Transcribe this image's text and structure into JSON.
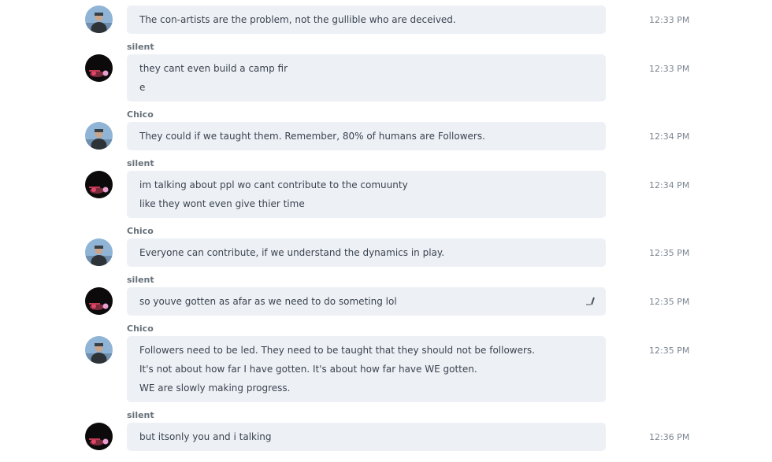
{
  "messages": [
    {
      "author": "",
      "avatar": "chico-avatar",
      "time": "12:33 PM",
      "lines": [
        "The con-artists are the problem, not the gullible who are deceived."
      ]
    },
    {
      "author": "silent",
      "avatar": "silent-avatar",
      "time": "12:33 PM",
      "lines": [
        "they cant even build a camp fir",
        "e"
      ]
    },
    {
      "author": "Chico",
      "avatar": "chico-avatar",
      "time": "12:34 PM",
      "lines": [
        "They could if we taught them.  Remember, 80% of humans are Followers."
      ]
    },
    {
      "author": "silent",
      "avatar": "silent-avatar",
      "time": "12:34 PM",
      "lines": [
        "im talking about ppl wo cant contribute to the comuunty",
        "like they wont even give thier time"
      ]
    },
    {
      "author": "Chico",
      "avatar": "chico-avatar",
      "time": "12:35 PM",
      "lines": [
        "Everyone can contribute, if we understand the dynamics in play."
      ]
    },
    {
      "author": "silent",
      "avatar": "silent-avatar",
      "time": "12:35 PM",
      "lines": [
        "so youve gotten  as afar as we need to do someting lol"
      ],
      "edit_icon": "edit-pencil-icon"
    },
    {
      "author": "Chico",
      "avatar": "chico-avatar",
      "time": "12:35 PM",
      "lines": [
        "Followers need to be led.  They need to be taught that they should not be followers.",
        "It's not about how far I have gotten.  It's about how far have WE gotten.",
        "WE are slowly making progress."
      ]
    },
    {
      "author": "silent",
      "avatar": "silent-avatar",
      "time": "12:36 PM",
      "lines": [
        "but itsonly you and i talking"
      ]
    }
  ],
  "colors": {
    "bubble_bg": "#edf1f5",
    "text": "#3b4350",
    "author": "#66717a",
    "time": "#7a8590"
  }
}
